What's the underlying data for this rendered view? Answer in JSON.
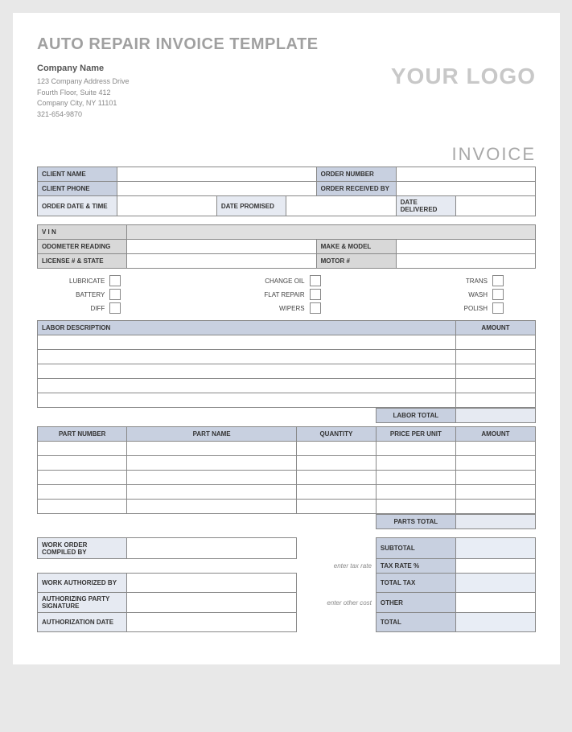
{
  "title": "AUTO REPAIR INVOICE TEMPLATE",
  "company": {
    "name": "Company Name",
    "addr1": "123 Company Address Drive",
    "addr2": "Fourth Floor, Suite 412",
    "citystate": "Company City, NY  11101",
    "phone": "321-654-9870"
  },
  "logo_text": "YOUR LOGO",
  "invoice_label": "INVOICE",
  "client_section": {
    "client_name_label": "CLIENT NAME",
    "client_phone_label": "CLIENT PHONE",
    "order_number_label": "ORDER NUMBER",
    "order_received_label": "ORDER RECEIVED BY",
    "order_date_label": "ORDER DATE & TIME",
    "date_promised_label": "DATE PROMISED",
    "date_delivered_label": "DATE DELIVERED"
  },
  "vehicle_section": {
    "vin_label": "V I N",
    "odometer_label": "ODOMETER READING",
    "make_model_label": "MAKE & MODEL",
    "license_label": "LICENSE # & STATE",
    "motor_label": "MOTOR #"
  },
  "checks": {
    "col1": [
      "LUBRICATE",
      "BATTERY",
      "DIFF"
    ],
    "col2": [
      "CHANGE OIL",
      "FLAT REPAIR",
      "WIPERS"
    ],
    "col3": [
      "TRANS",
      "WASH",
      "POLISH"
    ]
  },
  "labor": {
    "desc_label": "LABOR DESCRIPTION",
    "amount_label": "AMOUNT",
    "total_label": "LABOR TOTAL"
  },
  "parts": {
    "pn_label": "PART NUMBER",
    "name_label": "PART NAME",
    "qty_label": "QUANTITY",
    "ppu_label": "PRICE PER UNIT",
    "amount_label": "AMOUNT",
    "total_label": "PARTS TOTAL"
  },
  "auth": {
    "compiled_label": "WORK ORDER COMPILED BY",
    "authorized_label": "WORK AUTHORIZED BY",
    "signature_label": "AUTHORIZING PARTY SIGNATURE",
    "date_label": "AUTHORIZATION DATE"
  },
  "totals": {
    "tax_hint": "enter tax rate",
    "other_hint": "enter other cost",
    "subtotal_label": "SUBTOTAL",
    "taxrate_label": "TAX RATE %",
    "totaltax_label": "TOTAL TAX",
    "other_label": "OTHER",
    "total_label": "TOTAL"
  }
}
